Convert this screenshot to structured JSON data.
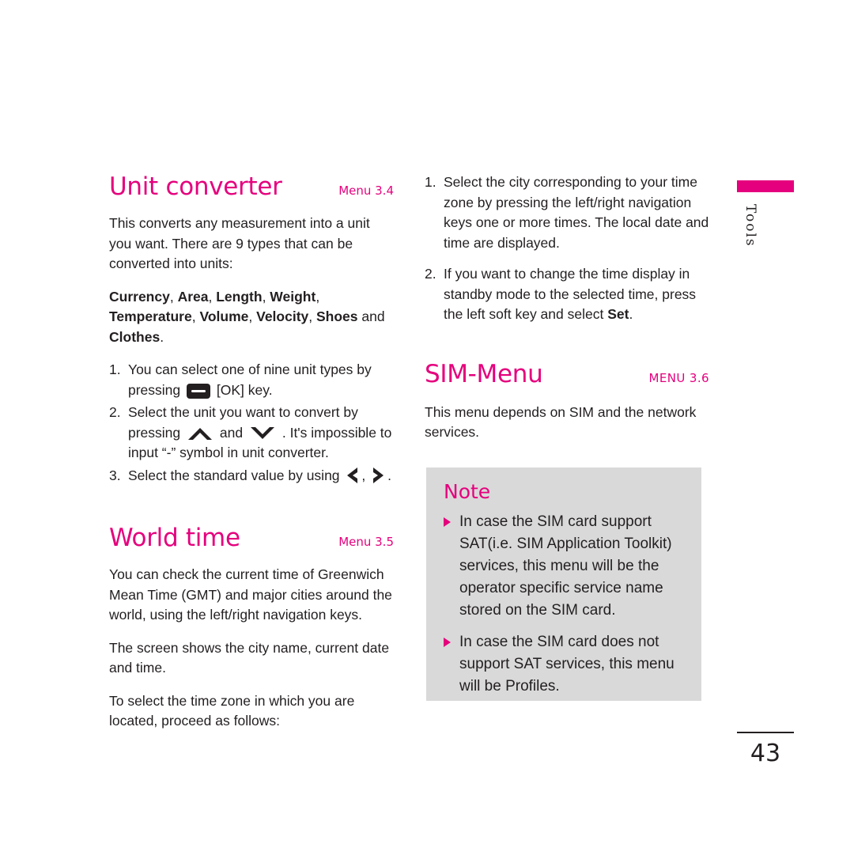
{
  "left_column": {
    "section1": {
      "title": "Unit converter",
      "menu_ref": "Menu 3.4",
      "intro": "This converts any measurement into a unit you want. There are 9 types that can be converted into units:",
      "types_line1_bold": [
        "Currency",
        "Area",
        "Length",
        "Weight"
      ],
      "types_line2_bold": [
        "Temperature",
        "Volume",
        "Velocity",
        "Shoes"
      ],
      "types_tail": "and",
      "types_last_bold": "Clothes",
      "steps": [
        {
          "num": "1.",
          "text_before": "You can select one of nine unit types by pressing",
          "icon": "ok-key-icon",
          "text_after": "[OK] key."
        },
        {
          "num": "2.",
          "text_before": "Select the unit you want to convert by pressing",
          "icon_a": "up-arrow-key-icon",
          "mid": "and",
          "icon_b": "down-arrow-key-icon",
          "text_after": ". It's impossible to input “-” symbol in",
          "text_after2": "unit converter."
        },
        {
          "num": "3.",
          "text_before": "Select the standard value by using",
          "icon_a": "left-arrow-key-icon",
          "separator": ",",
          "icon_b": "right-arrow-key-icon",
          "text_after": "."
        }
      ]
    },
    "section2": {
      "title": "World time",
      "menu_ref": "Menu 3.5",
      "paragraphs": [
        "You can check the current time of Greenwich Mean Time (GMT) and major cities around the world, using the left/right navigation keys.",
        "The screen shows the city name, current date and time.",
        "To select the time zone in which you are located, proceed as follows:"
      ]
    }
  },
  "right_column": {
    "steps": [
      {
        "num": "1.",
        "text": "Select the city corresponding to your time zone by pressing the left/right navigation keys one or more times. The local date and time are displayed."
      },
      {
        "num": "2.",
        "text_before": "If you want to change the time display in standby mode to the selected time, press the left soft key and select",
        "bold": "Set",
        "text_after": "."
      }
    ],
    "section": {
      "title": "SIM-Menu",
      "menu_ref": "MENU 3.6",
      "paragraph": "This menu depends on SIM and the network services."
    },
    "note": {
      "title": "Note",
      "items": [
        "In case the SIM card support SAT(i.e. SIM Application Toolkit) services, this menu will be the operator specific service name stored on the SIM card.",
        "In case the SIM card does not support SAT services, this menu will be Profiles."
      ]
    }
  },
  "sidebar": {
    "tab_label": "Tools",
    "accent_color": "#e5007d"
  },
  "footer": {
    "page_number": "43"
  }
}
